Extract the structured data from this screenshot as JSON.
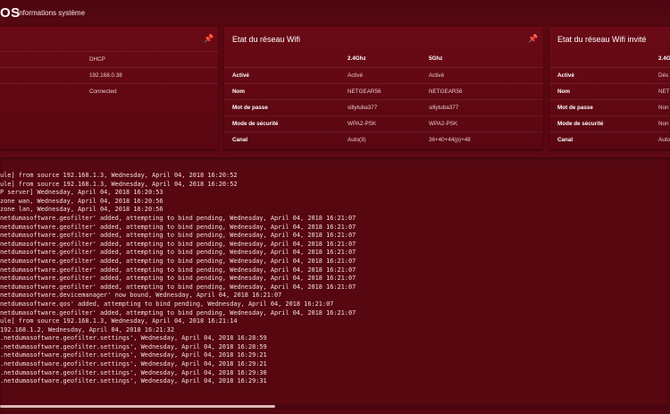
{
  "header": {
    "brand": "OS",
    "title": "Informations système"
  },
  "icons": {
    "pin": "pin-icon"
  },
  "network_panel": {
    "rows": [
      {
        "value": "DHCP"
      },
      {
        "value": "192.168.0.38"
      },
      {
        "value": "Connected"
      }
    ]
  },
  "wifi_panel": {
    "title": "Etat du réseau Wifi",
    "columns": [
      "2.4Ghz",
      "5Ghz"
    ],
    "rows": [
      {
        "label": "Activé",
        "v24": "Activé",
        "v5": "Activé"
      },
      {
        "label": "Nom",
        "v24": "NETGEAR56",
        "v5": "NETGEAR56"
      },
      {
        "label": "Mot de passe",
        "v24": "sillytuba377",
        "v5": "sillytuba377"
      },
      {
        "label": "Mode de sécurité",
        "v24": "WPA2-PSK",
        "v5": "WPA2-PSK"
      },
      {
        "label": "Canal",
        "v24": "Auto(3)",
        "v5": "36+40+44(p)+48"
      }
    ]
  },
  "guest_panel": {
    "title": "Etat du réseau Wifi invité",
    "columns": [
      "2.4G"
    ],
    "rows": [
      {
        "label": "Activé",
        "v24": "Dés"
      },
      {
        "label": "Nom",
        "v24": "NET"
      },
      {
        "label": "Mot de passe",
        "v24": "Non"
      },
      {
        "label": "Mode de sécurité",
        "v24": "Non"
      },
      {
        "label": "Canal",
        "v24": "Auto"
      }
    ]
  },
  "log": {
    "lines": [
      "ule] from source 192.168.1.3, Wednesday, April 04, 2018 16:20:52",
      "ule] from source 192.168.1.3, Wednesday, April 04, 2018 16:20:52",
      "P server] Wednesday, April 04, 2018 16:20:53",
      "zone wan, Wednesday, April 04, 2018 16:20:56",
      "zone lan, Wednesday, April 04, 2018 16:20:56",
      "netdumasoftware.geofilter' added, attempting to bind pending, Wednesday, April 04, 2018 16:21:07",
      "netdumasoftware.geofilter' added, attempting to bind pending, Wednesday, April 04, 2018 16:21:07",
      "netdumasoftware.geofilter' added, attempting to bind pending, Wednesday, April 04, 2018 16:21:07",
      "netdumasoftware.geofilter' added, attempting to bind pending, Wednesday, April 04, 2018 16:21:07",
      "netdumasoftware.geofilter' added, attempting to bind pending, Wednesday, April 04, 2018 16:21:07",
      "netdumasoftware.geofilter' added, attempting to bind pending, Wednesday, April 04, 2018 16:21:07",
      "netdumasoftware.geofilter' added, attempting to bind pending, Wednesday, April 04, 2018 16:21:07",
      "netdumasoftware.geofilter' added, attempting to bind pending, Wednesday, April 04, 2018 16:21:07",
      "netdumasoftware.geofilter' added, attempting to bind pending, Wednesday, April 04, 2018 16:21:07",
      "netdumasoftware.devicemanager' now bound, Wednesday, April 04, 2018 16:21:07",
      "netdumasoftware.qos' added, attempting to bind pending, Wednesday, April 04, 2018 16:21:07",
      "netdumasoftware.geofilter' added, attempting to bind pending, Wednesday, April 04, 2018 16:21:07",
      "ule] from source 192.168.1.3, Wednesday, April 04, 2018 16:21:14",
      "192.168.1.2, Wednesday, April 04, 2018 16:21:32",
      ".netdumasoftware.geofilter.settings', Wednesday, April 04, 2018 16:28:59",
      ".netdumasoftware.geofilter.settings', Wednesday, April 04, 2018 16:28:59",
      ".netdumasoftware.geofilter.settings', Wednesday, April 04, 2018 16:29:21",
      ".netdumasoftware.geofilter.settings', Wednesday, April 04, 2018 16:29:21",
      ".netdumasoftware.geofilter.settings', Wednesday, April 04, 2018 16:29:30",
      ".netdumasoftware.geofilter.settings', Wednesday, April 04, 2018 16:29:31"
    ],
    "scroll_position": 0.41
  },
  "colors": {
    "background": "#5e0812",
    "panel": "#6a0a16",
    "text": "#f1dcdc"
  }
}
